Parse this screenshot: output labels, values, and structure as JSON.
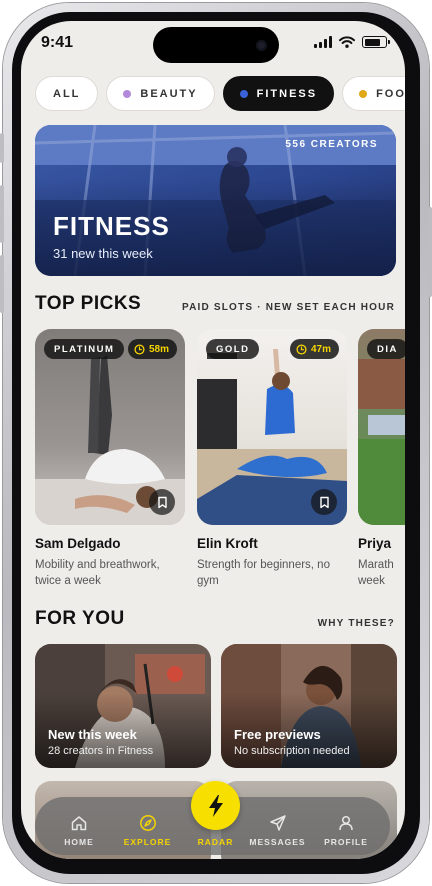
{
  "status": {
    "time": "9:41"
  },
  "chips": [
    {
      "label": "ALL",
      "dot": null
    },
    {
      "label": "BEAUTY",
      "dot": "#b28ad9"
    },
    {
      "label": "FITNESS",
      "dot": "#3b63d8"
    },
    {
      "label": "FOOD",
      "dot": "#e0a817"
    }
  ],
  "hero": {
    "count": "556 CREATORS",
    "title": "FITNESS",
    "subtitle": "31 new this week"
  },
  "top_picks": {
    "title": "TOP PICKS",
    "meta": "PAID SLOTS · NEW SET EACH HOUR",
    "items": [
      {
        "tier": "PLATINUM",
        "time": "58m",
        "name": "Sam Delgado",
        "desc": "Mobility and breathwork, twice a week"
      },
      {
        "tier": "GOLD",
        "time": "47m",
        "name": "Elin Kroft",
        "desc": "Strength for beginners, no gym"
      },
      {
        "tier": "DIA",
        "name": "Priya",
        "desc": "Marath week"
      }
    ]
  },
  "for_you": {
    "title": "FOR YOU",
    "meta": "WHY THESE?",
    "cards": [
      {
        "title": "New this week",
        "subtitle": "28 creators in Fitness"
      },
      {
        "title": "Free previews",
        "subtitle": "No subscription needed"
      }
    ]
  },
  "tabbar": {
    "home": "HOME",
    "explore": "EXPLORE",
    "radar": "RADAR",
    "messages": "MESSAGES",
    "profile": "PROFILE"
  },
  "colors": {
    "accent": "#f7e000",
    "active_chip": "#111111",
    "background": "#efedea"
  }
}
